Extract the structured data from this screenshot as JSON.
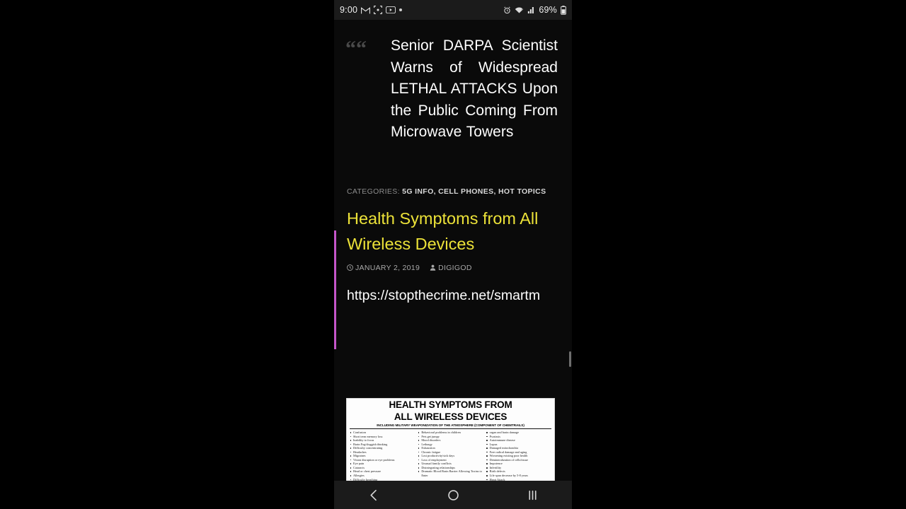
{
  "status_bar": {
    "time": "9:00",
    "left_icons": [
      "gmail-icon",
      "photos-icon",
      "youtube-icon",
      "dot-indicator"
    ],
    "alarm_icon": "alarm-icon",
    "wifi_icon": "wifi-icon",
    "signal_icon": "signal-bars-icon",
    "battery_percent": "69%",
    "battery_icon": "battery-icon"
  },
  "article": {
    "quote_mark": "“",
    "quote_text": "Senior DARPA Scientist Warns of Widespread LETHAL ATTACKS Upon the Public Coming From Microwave Towers",
    "categories_label": "CATEGORIES:",
    "categories": [
      "5G INFO",
      "CELL PHONES",
      "HOT TOPICS"
    ],
    "categories_line": "5G INFO, CELL PHONES, HOT TOPICS",
    "title": "Health Symptoms from All Wireless Devices",
    "date": "JANUARY 2, 2019",
    "author": "DIGIGOD",
    "url": "https://stopthecrime.net/smartm",
    "accent_color": "#c556c9",
    "title_color": "#ece238"
  },
  "infographic": {
    "heading_line1": "HEALTH SYMPTOMS FROM",
    "heading_line2": "ALL WIRELESS DEVICES",
    "subheading": "INCLUDING MILITARY WEAPONIZATION OF THE ATMOSPHERE (COMPONENT OF CHEMTRAILS)",
    "columns": [
      [
        "Confusion",
        "Short term memory loss",
        "Inability to focus",
        "Brain Fog/sluggish thinking",
        "Difficulty concentrating",
        "Headaches",
        "Migraines",
        "Vision disruption or eye problems",
        "Eye pain",
        "Cataracts",
        "Head or chest pressure",
        "Allergies",
        "Difficulty breathing"
      ],
      [
        "Behavioral problems in children",
        "Pets get jumpy",
        "Mood disorders",
        "Lethargy",
        "Exhaustion",
        "Chronic fatigue",
        "Lost productivity/sick days",
        "Loss of employment",
        "Unusual family conflicts",
        "Disintegrating relationships",
        "Dramatic Blood Brain Barrier Allowing Toxins to Enter"
      ],
      [
        "organ and brain damage",
        "Psoriasis",
        "Autoimmune disease",
        "Lupus",
        "Damaged mitochondria",
        "Free radical damage and aging",
        "Worsening existing poor health",
        "Demineralization of cells/tissue",
        "Impotence",
        "Infertility",
        "Birth defects",
        "Life span decrease by 5-8 years",
        "Heart Attack"
      ]
    ]
  },
  "nav_bar": {
    "back_label": "Back",
    "home_label": "Home",
    "recents_label": "Recents"
  }
}
